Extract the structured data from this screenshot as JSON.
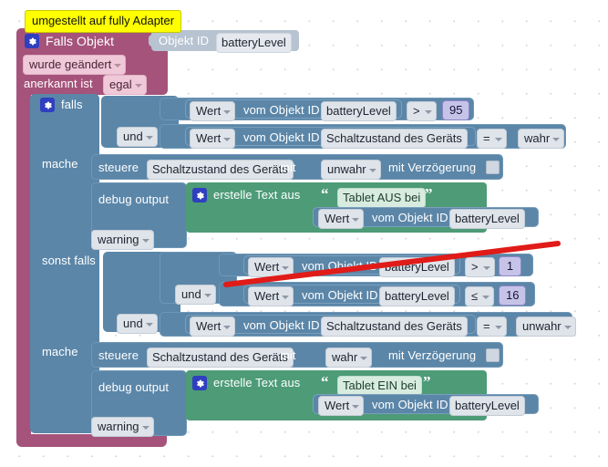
{
  "app": {
    "kind": "blockly-visual-script-editor",
    "language": "de"
  },
  "comment": {
    "text": "umgestellt auf fully Adapter"
  },
  "colors": {
    "hat_block": "#a5537b",
    "control_block": "#5b86a8",
    "text_block": "#4d9b77",
    "number_shadow": "#c6c3e8",
    "gear_icon": "#2f3fbf",
    "comment_bubble": "#ffff00",
    "annotation_arrow": "#e01b18",
    "canvas": "#ffffff"
  },
  "trigger": {
    "title": "Falls Objekt",
    "object_id_label": "Objekt ID",
    "object_id_value": "batteryLevel",
    "change_type": "wurde geändert",
    "ack_label": "anerkannt ist",
    "ack_value": "egal"
  },
  "if_block": {
    "if_label": "falls",
    "elseif_label": "sonst falls",
    "do_label": "mache",
    "branches": [
      {
        "name": "if-branch",
        "conditions": [
          {
            "getter_label": "Wert",
            "from_label": "vom Objekt ID",
            "object_id": "batteryLevel",
            "operator": ">",
            "compare_value": "95",
            "compare_kind": "number"
          },
          {
            "join": "und",
            "getter_label": "Wert",
            "from_label": "vom Objekt ID",
            "object_id": "Schaltzustand des Geräts",
            "operator": "=",
            "compare_value": "wahr",
            "compare_kind": "dropdown"
          }
        ],
        "statements": {
          "control": {
            "verb": "steuere",
            "target": "Schaltzustand des Geräts",
            "with_label": "mit",
            "value": "unwahr",
            "delay_label": "mit Verzögerung",
            "delay_checked": false
          },
          "debug": {
            "label": "debug output",
            "severity": "warning",
            "text_builder_label": "erstelle Text aus",
            "text_literal": "Tablet AUS bei",
            "appended_getter": {
              "getter_label": "Wert",
              "from_label": "vom Objekt ID",
              "object_id": "batteryLevel"
            }
          }
        }
      },
      {
        "name": "elseif-branch",
        "conditions": [
          {
            "getter_label": "Wert",
            "from_label": "vom Objekt ID",
            "object_id": "batteryLevel",
            "operator": ">",
            "compare_value": "1",
            "compare_kind": "number"
          },
          {
            "join": "und",
            "getter_label": "Wert",
            "from_label": "vom Objekt ID",
            "object_id": "batteryLevel",
            "operator": "≤",
            "compare_value": "16",
            "compare_kind": "number"
          },
          {
            "join": "und",
            "getter_label": "Wert",
            "from_label": "vom Objekt ID",
            "object_id": "Schaltzustand des Geräts",
            "operator": "=",
            "compare_value": "unwahr",
            "compare_kind": "dropdown"
          }
        ],
        "statements": {
          "control": {
            "verb": "steuere",
            "target": "Schaltzustand des Geräts",
            "with_label": "mit",
            "value": "wahr",
            "delay_label": "mit Verzögerung",
            "delay_checked": false
          },
          "debug": {
            "label": "debug output",
            "severity": "warning",
            "text_builder_label": "erstelle Text aus",
            "text_literal": "Tablet EIN bei",
            "appended_getter": {
              "getter_label": "Wert",
              "from_label": "vom Objekt ID",
              "object_id": "batteryLevel"
            }
          }
        }
      }
    ]
  }
}
